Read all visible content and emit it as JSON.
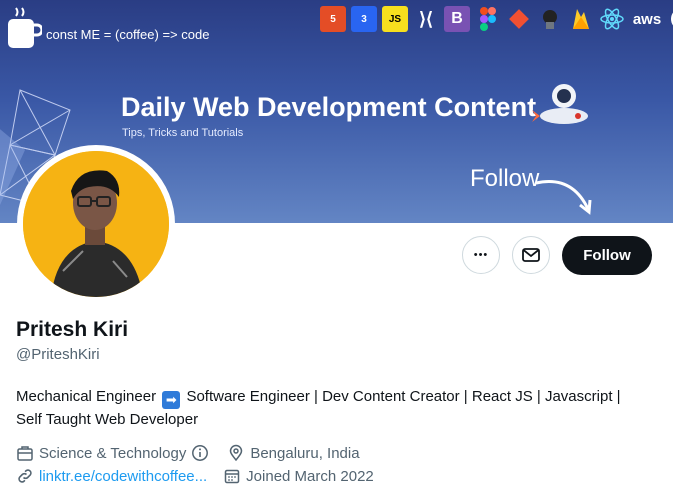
{
  "banner": {
    "tagline": "const ME = (coffee) => code",
    "title": "Daily Web Development Content",
    "subtitle": "Tips, Tricks and Tutorials",
    "follow_text": "Follow",
    "tech_icons": [
      "html5-icon",
      "css3-icon",
      "js-icon",
      "vscode-icon",
      "bootstrap-icon",
      "figma-icon",
      "git-icon",
      "github-icon",
      "firebase-icon",
      "react-icon",
      "aws-icon",
      "gatsby-icon"
    ]
  },
  "actions": {
    "more_label": "•••",
    "follow_label": "Follow"
  },
  "profile": {
    "name": "Pritesh Kiri",
    "handle": "@PriteshKiri",
    "bio_part1": "Mechanical Engineer",
    "bio_arrow": "➡",
    "bio_part2": "Software Engineer | Dev Content Creator | React JS | Javascript | Self Taught Web Developer",
    "category": "Science & Technology",
    "location": "Bengaluru, India",
    "link": "linktr.ee/codewithcoffee...",
    "joined": "Joined March 2022"
  },
  "colors": {
    "banner_top": "#2a3d84",
    "banner_bottom": "#6385c4",
    "avatar_bg": "#f6b313",
    "follow_button": "#0f1419",
    "link": "#1d9bf0"
  }
}
